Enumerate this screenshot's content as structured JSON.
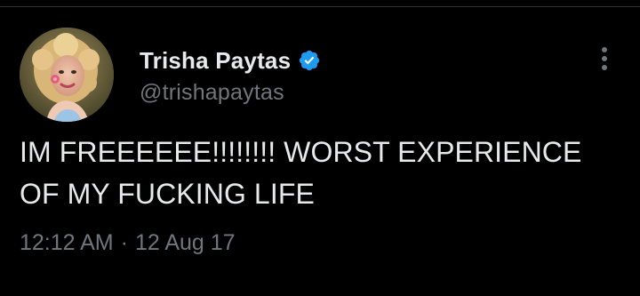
{
  "tweet": {
    "author": {
      "display_name": "Trisha Paytas",
      "handle": "@trishapaytas",
      "verified": true,
      "verified_color": "#1d9bf0"
    },
    "text_lines": [
      "IM FREEEEEE!!!!!!!! WORST EXPERIENCE",
      "OF MY FUCKING LIFE"
    ],
    "time": "12:12 AM",
    "separator": "·",
    "date": "12 Aug 17"
  },
  "icons": {
    "verified": "verified-badge-icon",
    "more": "more-options-icon"
  },
  "colors": {
    "background": "#000000",
    "primary_text": "#e7e9ea",
    "secondary_text": "#71767b"
  }
}
